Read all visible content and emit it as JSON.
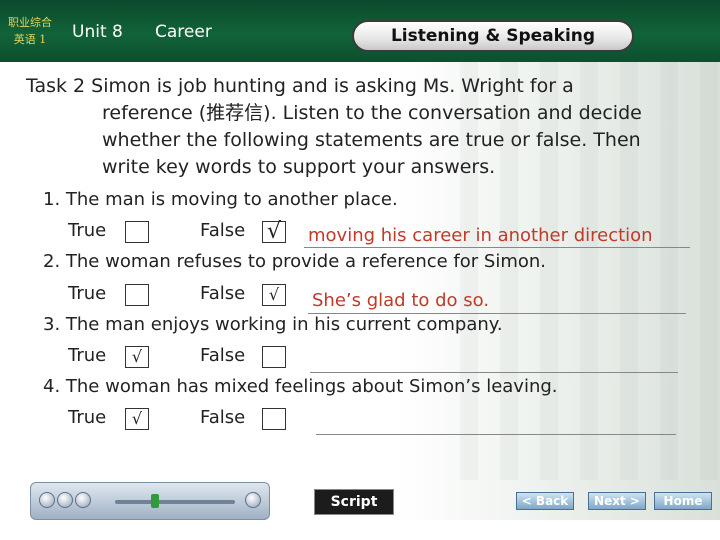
{
  "header": {
    "logo_line1": "职业综合",
    "logo_line2": "英语 1",
    "unit": "Unit 8",
    "topic": "Career",
    "section_button": "Listening & Speaking"
  },
  "task": {
    "line1": "Task 2 Simon is job hunting and is asking Ms. Wright for a",
    "line2": "reference (推荐信). Listen to the conversation and decide",
    "line3": "whether the following statements are true or false. Then",
    "line4": "write key words to support your answers."
  },
  "options": {
    "true_label": "True",
    "false_label": "False",
    "check": "√"
  },
  "questions": [
    {
      "text": "1. The man is moving to another place.",
      "answer": "False",
      "keywords": "moving his career in another direction"
    },
    {
      "text": "2. The woman refuses to provide a reference for Simon.",
      "answer": "False",
      "keywords": "She’s glad to do so."
    },
    {
      "text": "3. The man enjoys working in his current company.",
      "answer": "True",
      "keywords": ""
    },
    {
      "text": "4. The woman has mixed feelings about Simon’s leaving.",
      "answer": "True",
      "keywords": ""
    }
  ],
  "footer": {
    "script_button": "Script",
    "back_button": "< Back",
    "next_button": "Next >",
    "home_button": "Home"
  },
  "icons": [
    "play-icon",
    "pause-icon",
    "stop-icon",
    "volume-icon"
  ],
  "colors": {
    "header_green": "#116339",
    "answer_red": "#c03a28",
    "logo_gold": "#e6d45a"
  }
}
